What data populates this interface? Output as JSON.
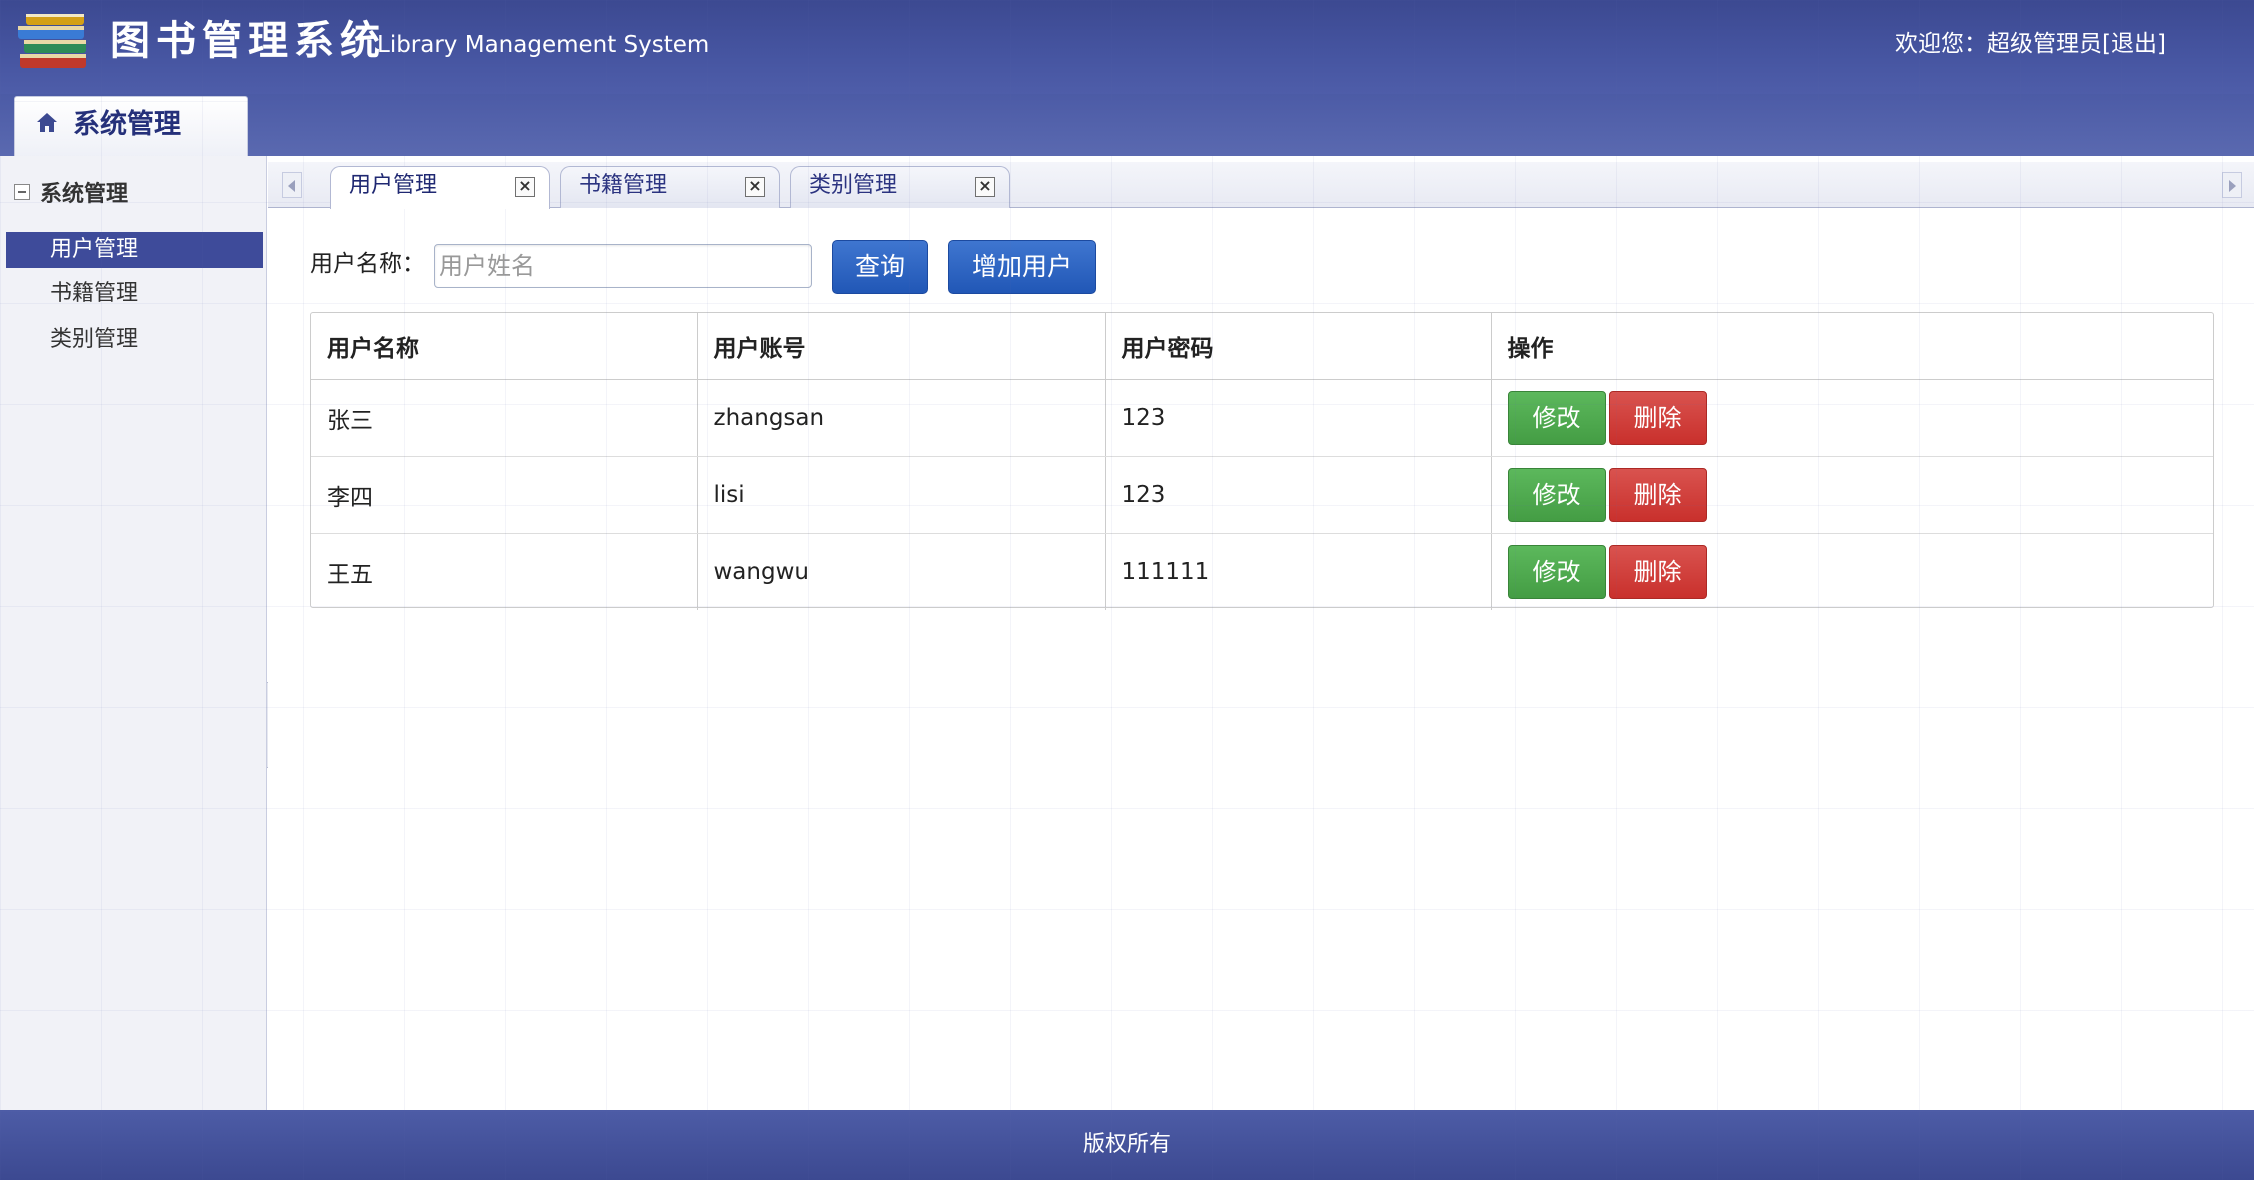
{
  "header": {
    "title": "图书管理系统",
    "subtitle": "Library Management System",
    "welcome_prefix": "欢迎您：",
    "user_name": "超级管理员",
    "logout": "[退出]"
  },
  "nav": {
    "active_tab": "系统管理"
  },
  "sidebar": {
    "section": "系统管理",
    "items": [
      {
        "label": "用户管理",
        "active": true
      },
      {
        "label": "书籍管理",
        "active": false
      },
      {
        "label": "类别管理",
        "active": false
      }
    ]
  },
  "tabs": [
    {
      "label": "用户管理",
      "active": true
    },
    {
      "label": "书籍管理",
      "active": false
    },
    {
      "label": "类别管理",
      "active": false
    }
  ],
  "search": {
    "label": "用户名称：",
    "placeholder": "用户姓名",
    "query_button": "查询",
    "add_button": "增加用户"
  },
  "table": {
    "columns": [
      "用户名称",
      "用户账号",
      "用户密码",
      "操作"
    ],
    "rows": [
      {
        "name": "张三",
        "account": "zhangsan",
        "password": "123"
      },
      {
        "name": "李四",
        "account": "lisi",
        "password": "123"
      },
      {
        "name": "王五",
        "account": "wangwu",
        "password": "111111"
      }
    ],
    "edit_label": "修改",
    "delete_label": "删除"
  },
  "footer": {
    "text": "版权所有"
  },
  "colors": {
    "header": "#4655a1",
    "sidebar_active": "#3e4b9a",
    "primary_button": "#2a62c2",
    "edit_button": "#4cae4c",
    "delete_button": "#d43f3a"
  }
}
